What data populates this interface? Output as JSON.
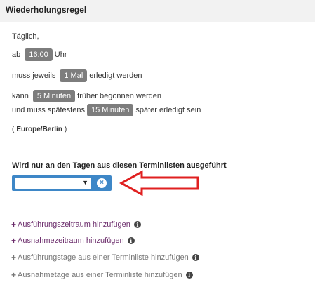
{
  "header": {
    "title": "Wiederholungsregel"
  },
  "rule": {
    "frequency": "Täglich,",
    "time_prefix": "ab",
    "time_value": "16:00",
    "time_suffix": "Uhr",
    "count_prefix": "muss jeweils",
    "count_value": "1 Mal",
    "count_suffix": "erledigt werden",
    "early_prefix": "kann",
    "early_value": "5 Minuten",
    "early_suffix": "früher begonnen werden",
    "late_prefix": "und muss spätestens",
    "late_value": "15 Minuten",
    "late_suffix": "später erledigt sein",
    "tz_open": "(",
    "timezone": "Europe/Berlin",
    "tz_close": ")"
  },
  "calendar": {
    "title": "Wird nur an den Tagen aus diesen Terminlisten ausgeführt",
    "select_value": "",
    "caret_glyph": "▼",
    "clear_glyph": "×"
  },
  "links": [
    {
      "label": "Ausführungszeitraum hinzufügen",
      "color": "#6b2c6b",
      "plus": "+",
      "info": "i"
    },
    {
      "label": "Ausnahmezeitraum hinzufügen",
      "color": "#6b2c6b",
      "plus": "+",
      "info": "i"
    },
    {
      "label": "Ausführungstage aus einer Terminliste hinzufügen",
      "color": "#777777",
      "plus": "+",
      "info": "i"
    },
    {
      "label": "Ausnahmetage aus einer Terminliste hinzufügen",
      "color": "#777777",
      "plus": "+",
      "info": "i"
    }
  ],
  "colors": {
    "accent": "#3e87c7",
    "pill": "#7d7d7d",
    "arrow": "#e02020"
  }
}
